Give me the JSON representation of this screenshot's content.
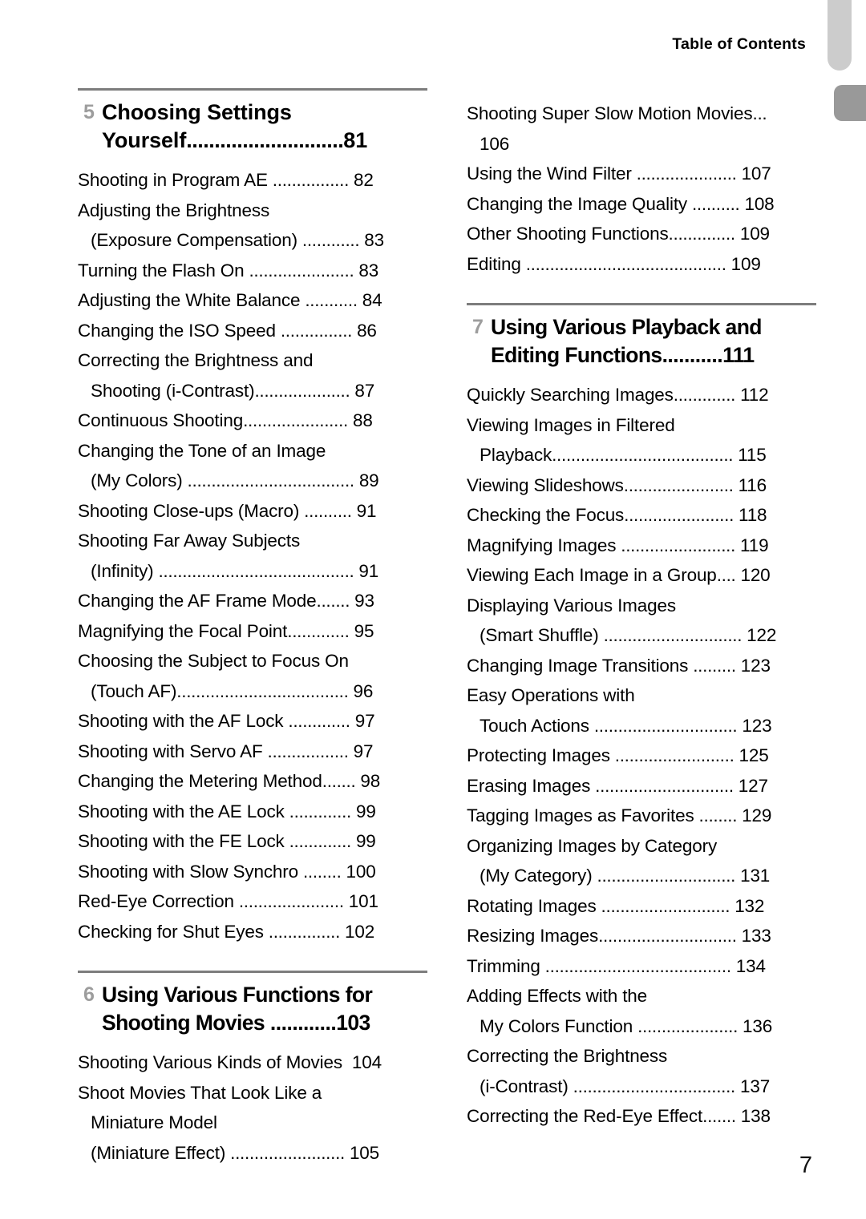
{
  "header": {
    "title": "Table of Contents"
  },
  "folio": {
    "page_number": "7"
  },
  "tabs": [
    {
      "name": "tab-marker-light",
      "color": "#cccccc"
    },
    {
      "name": "tab-marker-dark",
      "color": "#999999"
    }
  ],
  "left_column": {
    "groups": [
      {
        "chapter_number": "5",
        "chapter_title": "Choosing Settings Yourself",
        "chapter_title_line1": "Choosing Settings",
        "chapter_title_line2": "Yourself",
        "chapter_dots": "............................",
        "chapter_page": "81",
        "entries": [
          {
            "line1": "Shooting in Program AE",
            "dots": " ................ ",
            "page": "82"
          },
          {
            "line1": "Adjusting the Brightness",
            "line2": "(Exposure Compensation)",
            "dots": " ............ ",
            "page": "83"
          },
          {
            "line1": "Turning the Flash On",
            "dots": " ...................... ",
            "page": "83"
          },
          {
            "line1": "Adjusting the White Balance",
            "dots": " ........... ",
            "page": "84"
          },
          {
            "line1": "Changing the ISO Speed",
            "dots": " ............... ",
            "page": "86"
          },
          {
            "line1": "Correcting the Brightness and",
            "line2": "Shooting (i-Contrast)",
            "dots": ".................... ",
            "page": "87"
          },
          {
            "line1": "Continuous Shooting",
            "dots": "...................... ",
            "page": "88"
          },
          {
            "line1": "Changing the Tone of an Image",
            "line2": "(My Colors)",
            "dots": " ................................... ",
            "page": "89"
          },
          {
            "line1": "Shooting Close-ups (Macro)",
            "dots": " .......... ",
            "page": "91"
          },
          {
            "line1": "Shooting Far Away Subjects",
            "line2": "(Infinity)",
            "dots": " ......................................... ",
            "page": "91"
          },
          {
            "line1": "Changing the AF Frame Mode",
            "dots": "....... ",
            "page": "93"
          },
          {
            "line1": "Magnifying the Focal Point",
            "dots": "............. ",
            "page": "95"
          },
          {
            "line1": "Choosing the Subject to Focus On",
            "line2": "(Touch AF)",
            "dots": ".................................... ",
            "page": "96"
          },
          {
            "line1": "Shooting with the AF Lock",
            "dots": " ............. ",
            "page": "97"
          },
          {
            "line1": "Shooting with Servo AF",
            "dots": " ................. ",
            "page": "97"
          },
          {
            "line1": "Changing the Metering Method",
            "dots": "....... ",
            "page": "98"
          },
          {
            "line1": "Shooting with the AE Lock",
            "dots": " ............. ",
            "page": "99"
          },
          {
            "line1": "Shooting with the FE Lock",
            "dots": " ............. ",
            "page": "99"
          },
          {
            "line1": "Shooting with Slow Synchro",
            "dots": " ........ ",
            "page": "100"
          },
          {
            "line1": "Red-Eye Correction",
            "dots": " ...................... ",
            "page": "101"
          },
          {
            "line1": "Checking for Shut Eyes",
            "dots": " ............... ",
            "page": "102"
          }
        ]
      },
      {
        "chapter_number": "6",
        "chapter_title": "Using Various Functions for Shooting Movies",
        "chapter_title_line1": "Using Various Functions for",
        "chapter_title_line2": "Shooting Movies",
        "chapter_dots": " ............",
        "chapter_page": "103",
        "entries": [
          {
            "line1": "Shooting Various Kinds of Movies",
            "dots": "  ",
            "page": "104"
          },
          {
            "line1": "Shoot Movies That Look Like a",
            "line2": "Miniature Model",
            "line3": "(Miniature Effect)",
            "dots": " ........................ ",
            "page": "105"
          }
        ]
      }
    ]
  },
  "right_column": {
    "groups": [
      {
        "chapter_number": "",
        "chapter_title": "",
        "entries": [
          {
            "line1": "Shooting Super Slow Motion Movies",
            "dots": "...",
            "line2_is_page": true,
            "page": "106"
          },
          {
            "line1": "Using the Wind Filter",
            "dots": " ..................... ",
            "page": "107"
          },
          {
            "line1": "Changing the Image Quality",
            "dots": " .......... ",
            "page": "108"
          },
          {
            "line1": "Other Shooting Functions",
            "dots": ".............. ",
            "page": "109"
          },
          {
            "line1": "Editing",
            "dots": " .......................................... ",
            "page": "109"
          }
        ]
      },
      {
        "chapter_number": "7",
        "chapter_title": "Using Various Playback and Editing Functions",
        "chapter_title_line1": "Using Various Playback and",
        "chapter_title_line2": "Editing Functions",
        "chapter_dots": "...........",
        "chapter_page": "111",
        "entries": [
          {
            "line1": "Quickly Searching Images",
            "dots": "............. ",
            "page": "112"
          },
          {
            "line1": "Viewing Images in Filtered",
            "line2": "Playback",
            "dots": "...................................... ",
            "page": "115"
          },
          {
            "line1": "Viewing Slideshows",
            "dots": "....................... ",
            "page": "116"
          },
          {
            "line1": "Checking the Focus",
            "dots": "....................... ",
            "page": "118"
          },
          {
            "line1": "Magnifying Images",
            "dots": " ........................ ",
            "page": "119"
          },
          {
            "line1": "Viewing Each Image in a Group",
            "dots": ".... ",
            "page": "120"
          },
          {
            "line1": "Displaying Various Images",
            "line2": "(Smart Shuffle)",
            "dots": " ............................. ",
            "page": "122"
          },
          {
            "line1": "Changing Image Transitions",
            "dots": " ......... ",
            "page": "123"
          },
          {
            "line1": "Easy Operations with",
            "line2": "Touch Actions",
            "dots": " .............................. ",
            "page": "123"
          },
          {
            "line1": "Protecting Images",
            "dots": " ......................... ",
            "page": "125"
          },
          {
            "line1": "Erasing Images",
            "dots": " ............................. ",
            "page": "127"
          },
          {
            "line1": "Tagging Images as Favorites",
            "dots": " ........ ",
            "page": "129"
          },
          {
            "line1": "Organizing Images by Category",
            "line2": "(My Category)",
            "dots": " ............................. ",
            "page": "131"
          },
          {
            "line1": "Rotating Images",
            "dots": " ........................... ",
            "page": "132"
          },
          {
            "line1": "Resizing Images",
            "dots": "............................. ",
            "page": "133"
          },
          {
            "line1": "Trimming",
            "dots": " ....................................... ",
            "page": "134"
          },
          {
            "line1": "Adding Effects with the",
            "line2": "My Colors Function",
            "dots": " ..................... ",
            "page": "136"
          },
          {
            "line1": "Correcting the Brightness",
            "line2": "(i-Contrast)",
            "dots": " .................................. ",
            "page": "137"
          },
          {
            "line1": "Correcting the Red-Eye Effect",
            "dots": "....... ",
            "page": "138"
          }
        ]
      }
    ]
  }
}
